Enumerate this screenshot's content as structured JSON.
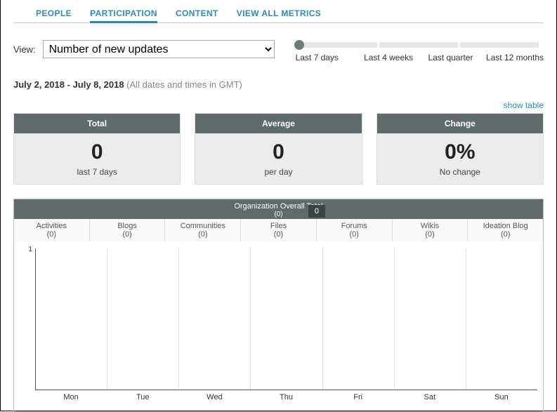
{
  "tabs": {
    "people": "PEOPLE",
    "participation": "PARTICIPATION",
    "content": "CONTENT",
    "view_all": "VIEW ALL METRICS",
    "active": "PARTICIPATION"
  },
  "view": {
    "label": "View:",
    "selected": "Number of new updates"
  },
  "range": {
    "options": [
      "Last 7 days",
      "Last 4 weeks",
      "Last quarter",
      "Last 12 months"
    ],
    "selected_index": 0
  },
  "date_line": {
    "start": "July 2, 2018",
    "separator": " - ",
    "end": "July 8, 2018",
    "gmt": " (All dates and times in GMT)"
  },
  "show_table": "show table",
  "cards": {
    "total": {
      "title": "Total",
      "value": "0",
      "sub": "last 7 days"
    },
    "average": {
      "title": "Average",
      "value": "0",
      "sub": "per day"
    },
    "change": {
      "title": "Change",
      "value": "0%",
      "sub": "No change"
    }
  },
  "chart_header": {
    "title": "Organization Overall Total",
    "count": "(0)",
    "badge": "0"
  },
  "series_tabs": [
    {
      "label": "Activities",
      "count": "(0)"
    },
    {
      "label": "Blogs",
      "count": "(0)"
    },
    {
      "label": "Communities",
      "count": "(0)"
    },
    {
      "label": "Files",
      "count": "(0)"
    },
    {
      "label": "Forums",
      "count": "(0)"
    },
    {
      "label": "Wikis",
      "count": "(0)"
    },
    {
      "label": "Ideation Blog",
      "count": "(0)"
    }
  ],
  "chart_data": {
    "type": "line",
    "categories": [
      "Mon",
      "Tue",
      "Wed",
      "Thu",
      "Fri",
      "Sat",
      "Sun"
    ],
    "values": [
      0,
      0,
      0,
      0,
      0,
      0,
      0
    ],
    "ylabel": "",
    "xlabel": "",
    "ylim": [
      0,
      1
    ],
    "yticks": [
      1
    ]
  }
}
